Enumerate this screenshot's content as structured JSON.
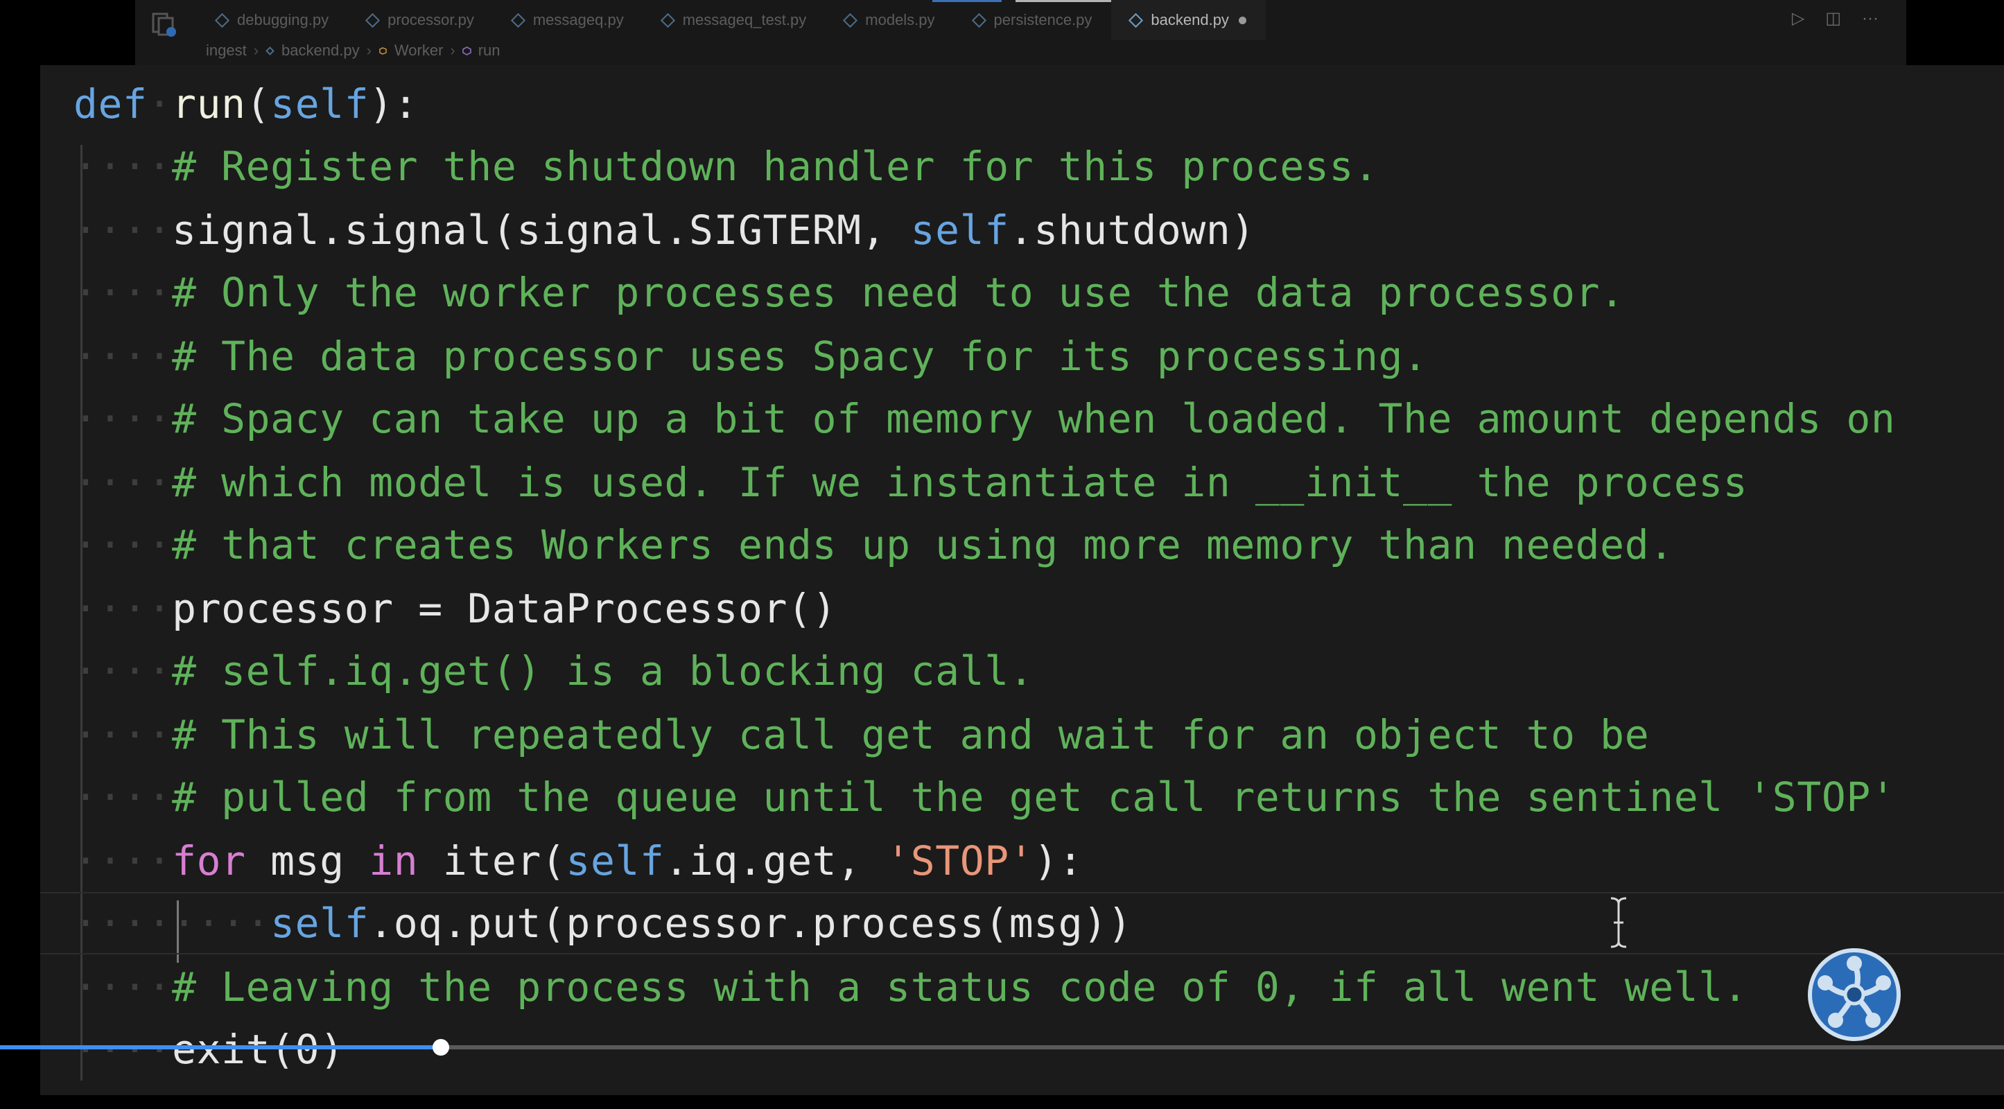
{
  "tabs": [
    {
      "label": "debugging.py",
      "active": false,
      "modified": false
    },
    {
      "label": "processor.py",
      "active": false,
      "modified": false
    },
    {
      "label": "messageq.py",
      "active": false,
      "modified": false
    },
    {
      "label": "messageq_test.py",
      "active": false,
      "modified": false
    },
    {
      "label": "models.py",
      "active": false,
      "modified": false
    },
    {
      "label": "persistence.py",
      "active": false,
      "modified": false
    },
    {
      "label": "backend.py",
      "active": true,
      "modified": true
    }
  ],
  "breadcrumb": [
    "ingest",
    "backend.py",
    "Worker",
    "run"
  ],
  "editor_actions": [
    "▷",
    "◫",
    "···"
  ],
  "code": {
    "l0": {
      "kw": "def",
      "fn": "run",
      "p1": "(",
      "kw2": "self",
      "p2": "):"
    },
    "l1": "# Register the shutdown handler for this process.",
    "l2": {
      "a": "signal.signal(signal.SIGTERM, ",
      "kw": "self",
      "b": ".shutdown)"
    },
    "l3": "# Only the worker processes need to use the data processor.",
    "l4": "# The data processor uses Spacy for its processing.",
    "l5": "# Spacy can take up a bit of memory when loaded. The amount depends on",
    "l6": "# which model is used. If we instantiate in __init__ the process",
    "l7": "# that creates Workers ends up using more memory than needed.",
    "l8": "processor = DataProcessor()",
    "l9": "# self.iq.get() is a blocking call.",
    "l10": "# This will repeatedly call get and wait for an object to be",
    "l11": "# pulled from the queue until the get call returns the sentinel 'STOP'",
    "l12": {
      "ctl": "for",
      "a": " msg ",
      "ctl2": "in",
      "b": " iter(",
      "kw": "self",
      "c": ".iq.get, ",
      "str": "'STOP'",
      "d": "):"
    },
    "l13": {
      "kw": "self",
      "a": ".oq.put(processor.process(msg))"
    },
    "l14": "# Leaving the process with a status code of 0, if all went well.",
    "l15": "exit(0)"
  },
  "video_progress_percent": 22,
  "colors": {
    "keyword": "#67a5e1",
    "control": "#d67fd1",
    "string": "#e9967a",
    "comment": "#5fb25a",
    "text": "#e6e6e6",
    "progress": "#3e8ef0"
  }
}
